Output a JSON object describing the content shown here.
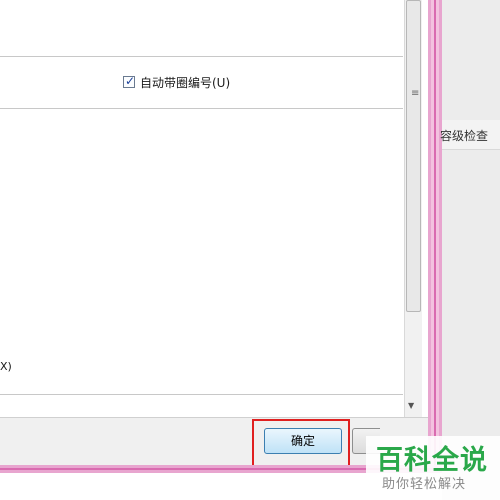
{
  "dialog": {
    "auto_number_label": "自动带圈编号(U)",
    "auto_number_checked": true,
    "cut_text": "X)",
    "ok_label": "确定"
  },
  "right_panel": {
    "label": "容级检查"
  },
  "watermark": {
    "title": "百科全说",
    "subtitle": "助你轻松解决"
  },
  "colors": {
    "frame_pink": "#e8a5cf",
    "highlight_red": "#e02020",
    "watermark_green": "#2aa84a"
  }
}
